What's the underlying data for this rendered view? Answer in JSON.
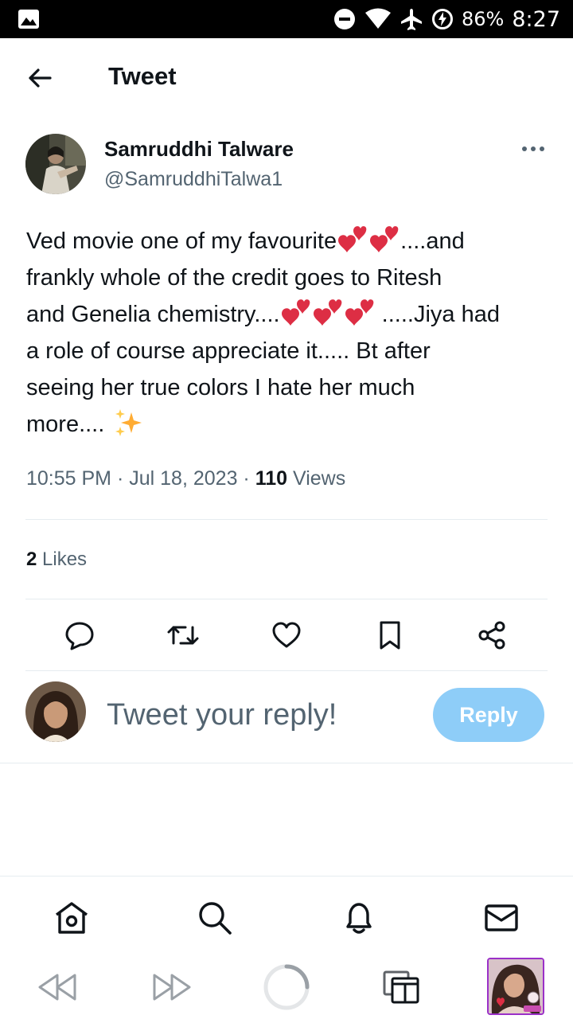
{
  "status_bar": {
    "battery": "86%",
    "time": "8:27"
  },
  "header": {
    "title": "Tweet"
  },
  "tweet": {
    "author_name": "Samruddhi Talware",
    "author_handle": "@SamruddhiTalwa1",
    "text_lines": [
      "Ved movie one of my favourite",
      "....and",
      "frankly whole of the credit goes to Ritesh",
      "and Genelia chemistry....",
      " .....Jiya had",
      "a role of course appreciate it..... Bt after",
      "seeing her true colors I hate her much",
      "more...."
    ],
    "time": "10:55 PM",
    "date": "Jul 18, 2023",
    "views_count": "110",
    "views_label": "Views",
    "likes_count": "2",
    "likes_label": "Likes"
  },
  "reply": {
    "placeholder": "Tweet your reply!",
    "button_label": "Reply"
  },
  "colors": {
    "accent": "#1d9bf0",
    "reply_button_disabled": "#8ecdf8",
    "secondary_text": "#536471",
    "heart_emoji": "#dd2e44",
    "sparkle_emoji": "#ffac33"
  },
  "icons": {
    "actions": [
      "reply-icon",
      "retweet-icon",
      "like-icon",
      "bookmark-icon",
      "share-icon"
    ],
    "bottom_nav": [
      "home-icon",
      "search-icon",
      "notifications-icon",
      "messages-icon"
    ],
    "browser": [
      "back-icon",
      "forward-icon",
      "reload-icon",
      "tabs-icon",
      "profile-picture"
    ]
  }
}
